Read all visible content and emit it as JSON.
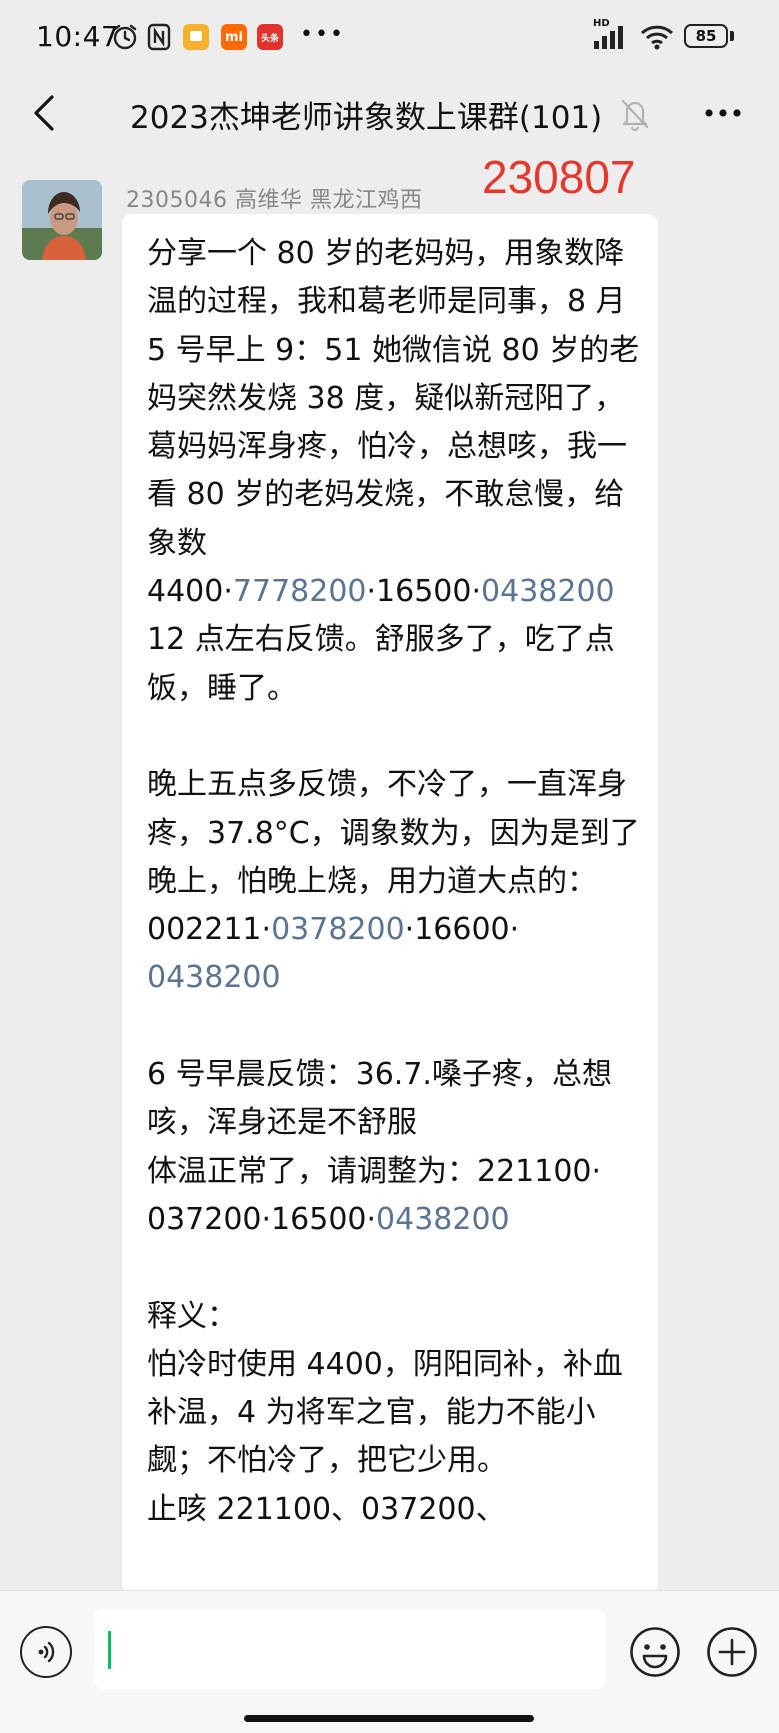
{
  "status_bar": {
    "time": "10:47",
    "battery": "85",
    "network_label": "HD",
    "more": "•••",
    "badges": {
      "notes": "",
      "mi": "mi",
      "toutiao": "头条"
    }
  },
  "header": {
    "title": "2023杰坤老师讲象数上课群(101)",
    "muted": true
  },
  "message": {
    "sender": "2305046   高维华  黑龙江鸡西",
    "stamp": "230807",
    "paragraphs": [
      [
        {
          "t": "分享一个 80 岁的老妈妈，用象数降温的过程，我和葛老师是同事，8 月 5 号早上 9：51 她微信说 80 岁的老妈突然发烧 38 度，疑似新冠阳了，葛妈妈浑身疼，怕冷，总想咳，我一看 80 岁的老妈发烧，不敢怠慢，给象数 4400·"
        },
        {
          "t": "7778200",
          "link": true
        },
        {
          "t": "·16500·"
        },
        {
          "t": "0438200",
          "link": true
        },
        {
          "t": "\n12 点左右反馈。舒服多了，吃了点饭，睡了。"
        }
      ],
      [
        {
          "t": " "
        }
      ],
      [
        {
          "t": "晚上五点多反馈，不冷了，一直浑身疼，37.8°C，调象数为，因为是到了晚上，怕晚上烧，用力道大点的：\n002211·"
        },
        {
          "t": "0378200",
          "link": true
        },
        {
          "t": "·16600·\n"
        },
        {
          "t": "0438200",
          "link": true
        }
      ],
      [
        {
          "t": " "
        }
      ],
      [
        {
          "t": "6 号早晨反馈：36.7.嗓子疼，总想咳，浑身还是不舒服\n体温正常了，请调整为：221100·\n037200·16500·"
        },
        {
          "t": "0438200",
          "link": true
        }
      ],
      [
        {
          "t": " "
        }
      ],
      [
        {
          "t": "释义：\n怕冷时使用 4400，阴阳同补，补血补温，4 为将军之官，能力不能小觑；不怕冷了，把它少用。\n止咳 221100、037200、"
        }
      ]
    ]
  },
  "colors": {
    "background": "#ededed",
    "bubble": "#ffffff",
    "link": "#5b7492",
    "stamp": "#e6372d",
    "cursor": "#07c160"
  },
  "input": {
    "value": ""
  }
}
